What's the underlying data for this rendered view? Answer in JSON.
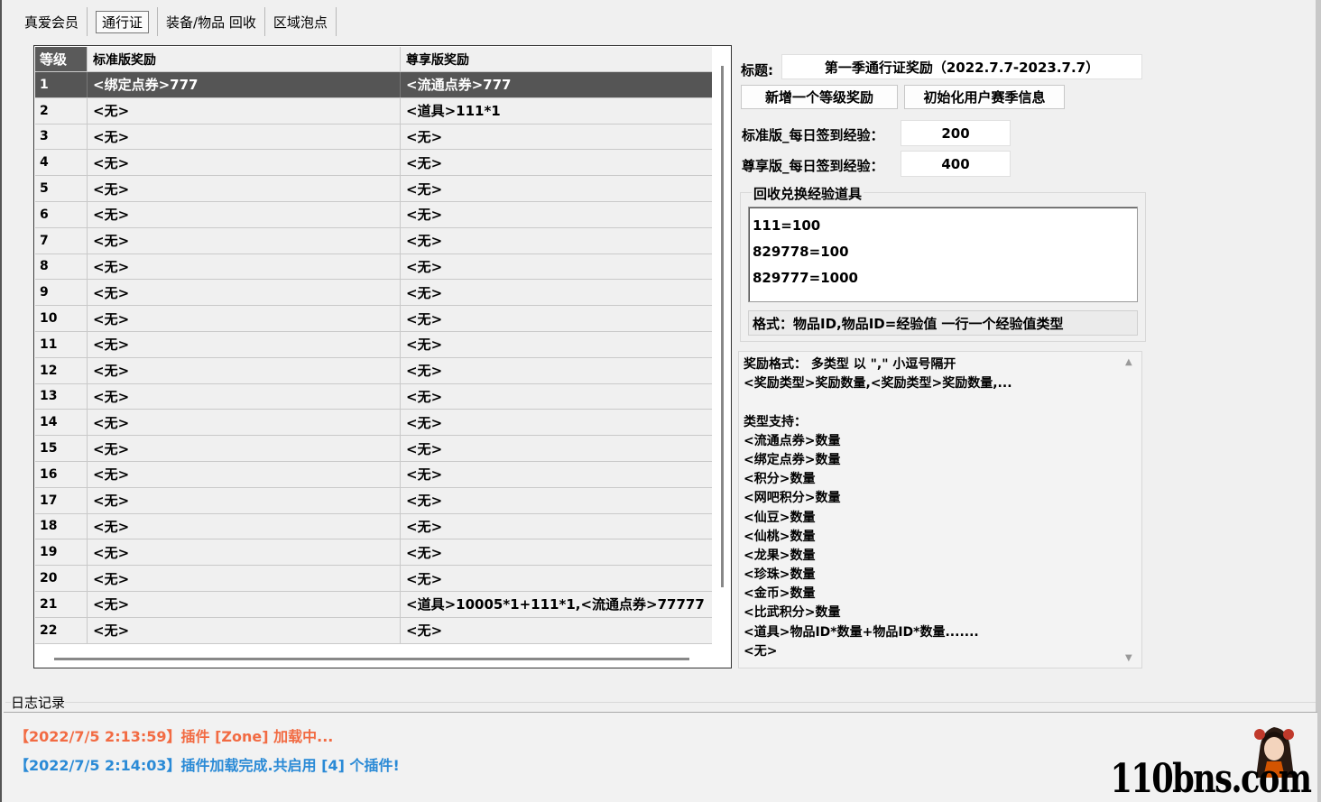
{
  "tabs": [
    "真爱会员",
    "通行证",
    "装备/物品 回收",
    "区域泡点"
  ],
  "grid": {
    "headers": [
      "等级",
      "标准版奖励",
      "尊享版奖励"
    ],
    "rows": [
      [
        "1",
        "<绑定点券>777",
        "<流通点券>777"
      ],
      [
        "2",
        "<无>",
        "<道具>111*1"
      ],
      [
        "3",
        "<无>",
        "<无>"
      ],
      [
        "4",
        "<无>",
        "<无>"
      ],
      [
        "5",
        "<无>",
        "<无>"
      ],
      [
        "6",
        "<无>",
        "<无>"
      ],
      [
        "7",
        "<无>",
        "<无>"
      ],
      [
        "8",
        "<无>",
        "<无>"
      ],
      [
        "9",
        "<无>",
        "<无>"
      ],
      [
        "10",
        "<无>",
        "<无>"
      ],
      [
        "11",
        "<无>",
        "<无>"
      ],
      [
        "12",
        "<无>",
        "<无>"
      ],
      [
        "13",
        "<无>",
        "<无>"
      ],
      [
        "14",
        "<无>",
        "<无>"
      ],
      [
        "15",
        "<无>",
        "<无>"
      ],
      [
        "16",
        "<无>",
        "<无>"
      ],
      [
        "17",
        "<无>",
        "<无>"
      ],
      [
        "18",
        "<无>",
        "<无>"
      ],
      [
        "19",
        "<无>",
        "<无>"
      ],
      [
        "20",
        "<无>",
        "<无>"
      ],
      [
        "21",
        "<无>",
        "<道具>10005*1+111*1,<流通点券>77777"
      ],
      [
        "22",
        "<无>",
        "<无>"
      ]
    ]
  },
  "panel": {
    "title_label": "标题:",
    "title_value": "第一季通行证奖励（2022.7.7-2023.7.7）",
    "add_level_button": "新增一个等级奖励",
    "init_season_button": "初始化用户赛季信息",
    "std_exp_label": "标准版_每日签到经验：",
    "std_exp_value": "200",
    "vip_exp_label": "尊享版_每日签到经验：",
    "vip_exp_value": "400",
    "recycle_group_title": "回收兑换经验道具",
    "recycle_lines": [
      "111=100",
      "829778=100",
      "829777=1000"
    ],
    "recycle_hint": "格式：物品ID,物品ID=经验值 一行一个经验值类型"
  },
  "help_lines": [
    "奖励格式： 多类型 以 \",\" 小逗号隔开",
    "<奖励类型>奖励数量,<奖励类型>奖励数量,...",
    "",
    "类型支持：",
    "<流通点券>数量",
    "<绑定点券>数量",
    "<积分>数量",
    "<网吧积分>数量",
    "<仙豆>数量",
    "<仙桃>数量",
    "<龙果>数量",
    "<珍珠>数量",
    "<金币>数量",
    "<比武积分>数量",
    "<道具>物品ID*数量+物品ID*数量.......",
    "<无>"
  ],
  "log": {
    "title": "日志记录",
    "entries": [
      {
        "text": "【2022/7/5 2:13:59】插件 [Zone] 加载中...",
        "color": "#f26b43"
      },
      {
        "text": "【2022/7/5 2:14:03】插件加载完成.共启用 [4] 个插件!",
        "color": "#2a8ad6"
      }
    ]
  },
  "watermark": "110bns.com"
}
